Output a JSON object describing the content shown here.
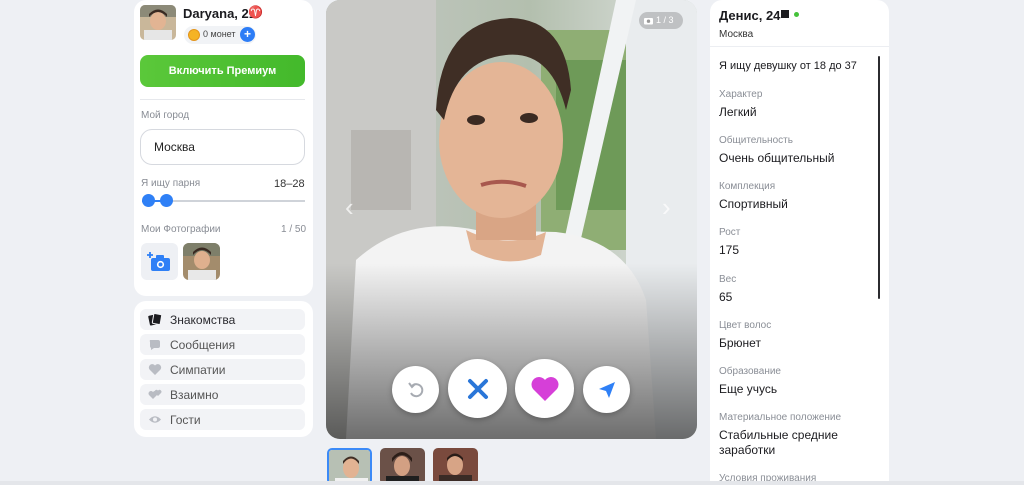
{
  "me": {
    "name": "Daryana, 21",
    "zodiac": "♈",
    "coins": "0 монет"
  },
  "premium_label": "Включить Премиум",
  "city": {
    "label": "Мой город",
    "value": "Москва"
  },
  "seeking": {
    "label": "Я ищу парня",
    "range": "18–28",
    "min_fraction": 0.0,
    "max_fraction": 0.11
  },
  "my_photos": {
    "label": "Мои Фотографии",
    "count": "1 / 50"
  },
  "nav": {
    "items": [
      {
        "label": "Знакомства",
        "icon": "cards-icon",
        "active": true
      },
      {
        "label": "Сообщения",
        "icon": "chat-icon",
        "active": false
      },
      {
        "label": "Симпатии",
        "icon": "heart-icon",
        "active": false
      },
      {
        "label": "Взаимно",
        "icon": "hearts-icon",
        "active": false
      },
      {
        "label": "Гости",
        "icon": "eye-icon",
        "active": false
      }
    ]
  },
  "viewer": {
    "counter": "1 / 3",
    "actions": [
      "undo-icon",
      "close-icon",
      "heart-icon",
      "send-icon"
    ]
  },
  "profile": {
    "name": "Денис, 24",
    "city": "Москва",
    "seeking": "Я ищу девушку от 18 до 37",
    "attributes": [
      {
        "label": "Характер",
        "value": "Легкий"
      },
      {
        "label": "Общительность",
        "value": "Очень общительный"
      },
      {
        "label": "Комплекция",
        "value": "Спортивный"
      },
      {
        "label": "Рост",
        "value": "175"
      },
      {
        "label": "Вес",
        "value": "65"
      },
      {
        "label": "Цвет волос",
        "value": "Брюнет"
      },
      {
        "label": "Образование",
        "value": "Еще учусь"
      },
      {
        "label": "Материальное положение",
        "value": "Стабильные средние заработки"
      },
      {
        "label": "Условия проживания",
        "value": ""
      }
    ]
  },
  "colors": {
    "accent": "#2f80f6",
    "premium": "#4cbf2f",
    "like": "#d63fd8",
    "dislike": "#2a76d8"
  }
}
